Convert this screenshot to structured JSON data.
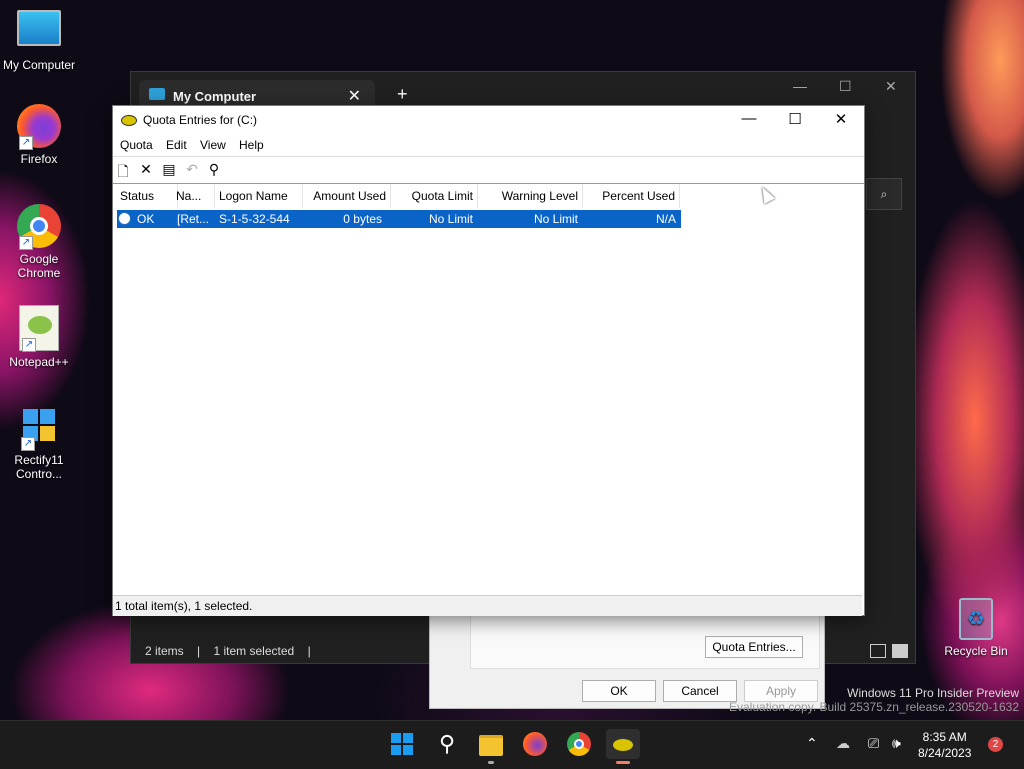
{
  "desktop": {
    "icons": [
      {
        "label": "My Computer"
      },
      {
        "label": "Firefox"
      },
      {
        "label": "Google Chrome"
      },
      {
        "label": "Notepad++"
      },
      {
        "label": "Rectify11 Contro..."
      }
    ],
    "recycle_bin": "Recycle Bin",
    "watermark": {
      "line1": "Windows 11 Pro Insider Preview",
      "line2": "Evaluation copy. Build 25375.zn_release.230520-1632"
    }
  },
  "explorer": {
    "tab_title": "My Computer",
    "status_items": "2 items",
    "status_selected": "1 item selected"
  },
  "properties_dialog": {
    "quota_entries_button": "Quota Entries...",
    "ok": "OK",
    "cancel": "Cancel",
    "apply": "Apply"
  },
  "quota_window": {
    "title": "Quota Entries for  (C:)",
    "menu": [
      "Quota",
      "Edit",
      "View",
      "Help"
    ],
    "columns": [
      "Status",
      "Na...",
      "Logon Name",
      "Amount Used",
      "Quota Limit",
      "Warning Level",
      "Percent Used"
    ],
    "rows": [
      {
        "status": "OK",
        "name": "[Ret...",
        "logon": "S-1-5-32-544",
        "amount": "0 bytes",
        "limit": "No Limit",
        "warning": "No Limit",
        "percent": "N/A"
      }
    ],
    "status_bar": "1 total item(s), 1 selected."
  },
  "taskbar": {
    "time": "8:35 AM",
    "date": "8/24/2023",
    "notification_count": "2"
  },
  "colors": {
    "selection": "#0a64c8",
    "taskbar": "#1c1c1c",
    "explorer_dark": "#202020"
  }
}
